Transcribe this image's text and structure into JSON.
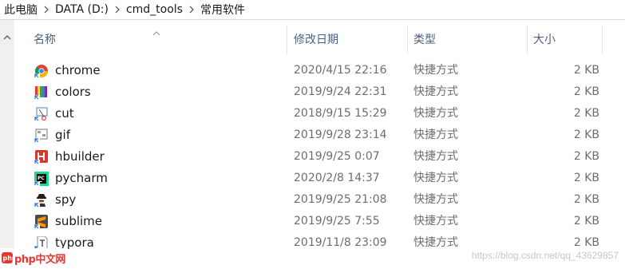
{
  "breadcrumb": [
    "此电脑",
    "DATA (D:)",
    "cmd_tools",
    "常用软件"
  ],
  "columns": {
    "name": "名称",
    "date": "修改日期",
    "type": "类型",
    "size": "大小"
  },
  "files": [
    {
      "name": "chrome",
      "date": "2020/4/15 22:16",
      "type": "快捷方式",
      "size": "2 KB",
      "icon": "chrome-icon"
    },
    {
      "name": "colors",
      "date": "2019/9/24 22:31",
      "type": "快捷方式",
      "size": "2 KB",
      "icon": "colors-icon"
    },
    {
      "name": "cut",
      "date": "2018/9/15 15:29",
      "type": "快捷方式",
      "size": "2 KB",
      "icon": "cut-icon"
    },
    {
      "name": "gif",
      "date": "2019/9/28 23:14",
      "type": "快捷方式",
      "size": "2 KB",
      "icon": "gif-icon"
    },
    {
      "name": "hbuilder",
      "date": "2019/9/25 0:07",
      "type": "快捷方式",
      "size": "2 KB",
      "icon": "hbuilder-icon"
    },
    {
      "name": "pycharm",
      "date": "2020/2/8 14:37",
      "type": "快捷方式",
      "size": "2 KB",
      "icon": "pycharm-icon"
    },
    {
      "name": "spy",
      "date": "2019/9/25 21:08",
      "type": "快捷方式",
      "size": "2 KB",
      "icon": "spy-icon"
    },
    {
      "name": "sublime",
      "date": "2019/9/25 7:55",
      "type": "快捷方式",
      "size": "2 KB",
      "icon": "sublime-icon"
    },
    {
      "name": "typora",
      "date": "2019/11/8 23:09",
      "type": "快捷方式",
      "size": "2 KB",
      "icon": "typora-icon"
    }
  ],
  "watermark": "https://blog.csdn.net/qq_43629857",
  "logo_text": "php中文网"
}
